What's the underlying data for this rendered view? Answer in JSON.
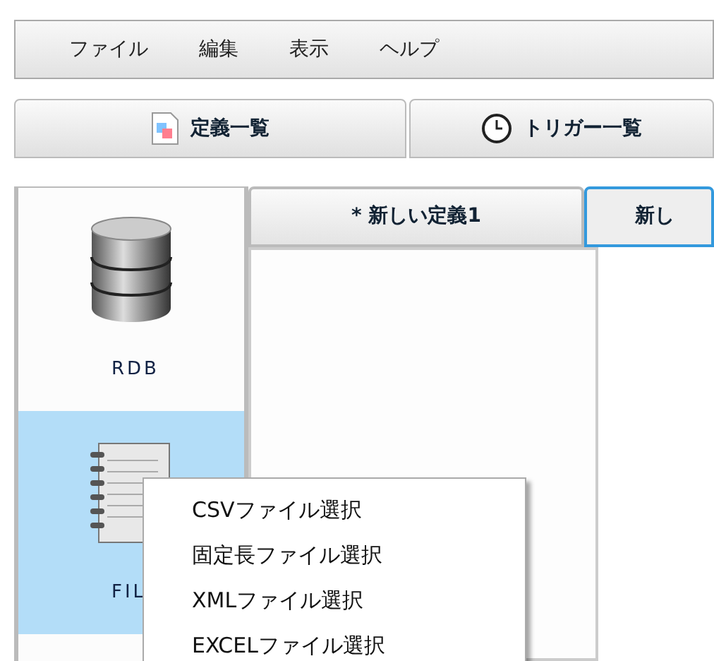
{
  "menu_bar": [
    {
      "label": "ファイル"
    },
    {
      "label": "編集"
    },
    {
      "label": "表示"
    },
    {
      "label": "ヘルプ"
    }
  ],
  "main_tabs": [
    {
      "label": "定義一覧",
      "kind": "document",
      "selected": false
    },
    {
      "label": "トリガー一覧",
      "kind": "clock",
      "selected": false
    }
  ],
  "palette": [
    {
      "label": "RDB",
      "kind": "database",
      "selected": false
    },
    {
      "label": "FIL",
      "kind": "notebook",
      "selected": true
    }
  ],
  "editor_tabs": [
    {
      "label": "* 新しい定義1",
      "selected": false
    },
    {
      "label": "新し",
      "selected": true
    }
  ],
  "context_menu": [
    {
      "label": "CSVファイル選択"
    },
    {
      "label": "固定長ファイル選択"
    },
    {
      "label": "XMLファイル選択"
    },
    {
      "label": "EXCELファイル選択"
    }
  ]
}
